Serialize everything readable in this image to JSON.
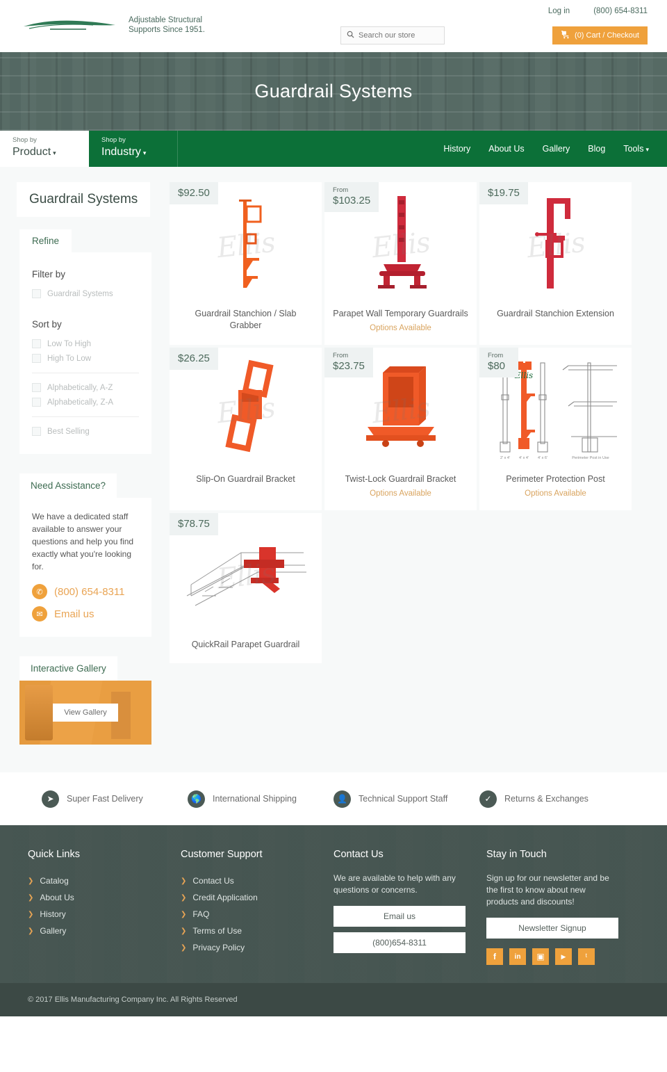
{
  "header": {
    "tagline": "Adjustable Structural\nSupports Since 1951.",
    "tagline_line1": "Adjustable Structural",
    "tagline_line2": "Supports Since 1951.",
    "login_label": "Log in",
    "phone": "(800) 654-8311",
    "search_placeholder": "Search our store",
    "cart_label": "(0) Cart / Checkout"
  },
  "hero": {
    "title": "Guardrail Systems"
  },
  "nav": {
    "shop_by_label": "Shop by",
    "shop_product": "Product",
    "shop_industry": "Industry",
    "links": [
      {
        "label": "History",
        "caret": false
      },
      {
        "label": "About Us",
        "caret": false
      },
      {
        "label": "Gallery",
        "caret": false
      },
      {
        "label": "Blog",
        "caret": false
      },
      {
        "label": "Tools",
        "caret": true
      }
    ]
  },
  "sidebar": {
    "category_title": "Guardrail Systems",
    "refine_label": "Refine",
    "filter_by_label": "Filter by",
    "filter_options": [
      "Guardrail Systems"
    ],
    "sort_by_label": "Sort by",
    "sort_group1": [
      "Low To High",
      "High To Low"
    ],
    "sort_group2": [
      "Alphabetically, A-Z",
      "Alphabetically, Z-A"
    ],
    "sort_group3": [
      "Best Selling"
    ],
    "assistance_title": "Need Assistance?",
    "assistance_text": "We have a dedicated staff available to answer your questions and help you find exactly what you're looking for.",
    "assistance_phone": "(800) 654-8311",
    "assistance_email": "Email us",
    "gallery_title": "Interactive Gallery",
    "gallery_button": "View Gallery"
  },
  "products": [
    {
      "price": "$92.50",
      "from": "",
      "title": "Guardrail Stanchion / Slab Grabber",
      "options": ""
    },
    {
      "price": "$103.25",
      "from": "From",
      "title": "Parapet Wall Temporary Guardrails",
      "options": "Options Available"
    },
    {
      "price": "$19.75",
      "from": "",
      "title": "Guardrail Stanchion Extension",
      "options": ""
    },
    {
      "price": "$26.25",
      "from": "",
      "title": "Slip-On Guardrail Bracket",
      "options": ""
    },
    {
      "price": "$23.75",
      "from": "From",
      "title": "Twist-Lock Guardrail Bracket",
      "options": "Options Available"
    },
    {
      "price": "$80",
      "from": "From",
      "title": "Perimeter Protection Post",
      "options": "Options Available"
    },
    {
      "price": "$78.75",
      "from": "",
      "title": "QuickRail Parapet Guardrail",
      "options": ""
    }
  ],
  "watermark": "Ellis",
  "features": [
    {
      "icon": "paper-plane-icon",
      "label": "Super Fast Delivery"
    },
    {
      "icon": "globe-icon",
      "label": "International Shipping"
    },
    {
      "icon": "user-icon",
      "label": "Technical Support Staff"
    },
    {
      "icon": "check-badge-icon",
      "label": "Returns & Exchanges"
    }
  ],
  "footer": {
    "quick_links_title": "Quick Links",
    "quick_links": [
      "Catalog",
      "About Us",
      "History",
      "Gallery"
    ],
    "support_title": "Customer Support",
    "support_links": [
      "Contact Us",
      "Credit Application",
      "FAQ",
      "Terms of Use",
      "Privacy Policy"
    ],
    "contact_title": "Contact Us",
    "contact_text": "We are available to help with any questions or concerns.",
    "contact_email_btn": "Email us",
    "contact_phone_btn": "(800)654-8311",
    "touch_title": "Stay in Touch",
    "touch_text": "Sign up for our newsletter and be the first to know about new products and discounts!",
    "newsletter_btn": "Newsletter Signup",
    "socials": [
      {
        "name": "facebook-icon",
        "glyph": "f"
      },
      {
        "name": "linkedin-icon",
        "glyph": "in"
      },
      {
        "name": "instagram-icon",
        "glyph": "▣"
      },
      {
        "name": "youtube-icon",
        "glyph": "▶"
      },
      {
        "name": "twitter-icon",
        "glyph": "ᵗ"
      }
    ],
    "copyright": "© 2017 Ellis Manufacturing Company Inc. All Rights Reserved"
  },
  "colors": {
    "brand_green": "#0c7038",
    "accent_orange": "#efa13c",
    "footer_dark": "#455450",
    "page_bg": "#f7f9f9"
  }
}
